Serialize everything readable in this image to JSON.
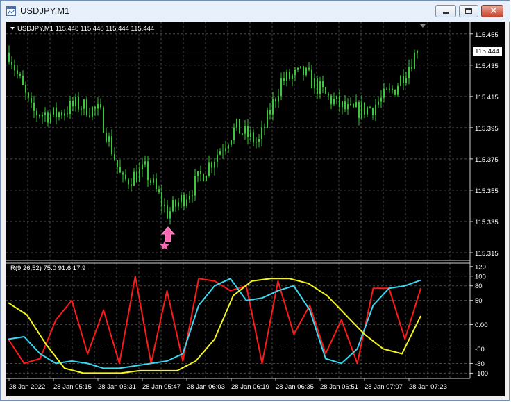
{
  "window": {
    "title": "USDJPY,M1",
    "buttons": [
      "minimize",
      "maximize",
      "close"
    ]
  },
  "colors": {
    "background": "#000000",
    "grid": "#4a4a4a",
    "candle": "#3cc83c",
    "text": "#ffffff",
    "red_line": "#ff1a1a",
    "cyan_line": "#3ad7f0",
    "yellow_line": "#f5f51e",
    "signal_arrow": "#ff69b4"
  },
  "price_panel": {
    "header": "USDJPY,M1  115.448 115.448 115.444 115.444",
    "current_price": "115.444",
    "price_labels": [
      "115.455",
      "115.435",
      "115.415",
      "115.395",
      "115.375",
      "115.355",
      "115.335",
      "115.315"
    ]
  },
  "indicator_panel": {
    "header": "R(9,26,52) 75.0 91.6 17.9",
    "scale_labels": [
      "120",
      "100",
      "80",
      "50",
      "0.00",
      "-50",
      "-80",
      "-100"
    ]
  },
  "time_axis": {
    "labels": [
      "28 Jan 2022",
      "28 Jan 05:15",
      "28 Jan 05:31",
      "28 Jan 05:47",
      "28 Jan 06:03",
      "28 Jan 06:19",
      "28 Jan 06:35",
      "28 Jan 06:51",
      "28 Jan 07:07",
      "28 Jan 07:23"
    ]
  },
  "signal": {
    "icon": "up-arrow-icon",
    "marker": "star-icon"
  },
  "chart_data": [
    {
      "type": "candlestick",
      "title": "USDJPY,M1",
      "y_range": [
        115.311,
        115.462
      ],
      "x": [
        "05:00",
        "05:08",
        "05:15",
        "05:23",
        "05:31",
        "05:39",
        "05:47",
        "05:55",
        "06:03",
        "06:11",
        "06:19",
        "06:27",
        "06:35",
        "06:43",
        "06:51",
        "06:59",
        "07:07",
        "07:15",
        "07:23"
      ],
      "close": [
        115.443,
        115.405,
        115.403,
        115.41,
        115.405,
        115.36,
        115.368,
        115.34,
        115.355,
        115.375,
        115.395,
        115.385,
        115.425,
        115.43,
        115.415,
        115.405,
        115.408,
        115.42,
        115.444
      ],
      "last": 115.444
    },
    {
      "type": "line",
      "title": "R(9,26,52)",
      "y_range": [
        -108,
        124
      ],
      "grid": true,
      "series": [
        {
          "values": [
            -30,
            -80,
            -70,
            10,
            50,
            -60,
            30,
            -80,
            100,
            -80,
            70,
            -75,
            95,
            90,
            70,
            80,
            -80,
            90,
            -20,
            40,
            -60,
            10,
            -80,
            75,
            75,
            -30,
            75
          ]
        },
        {
          "values": [
            -30,
            -25,
            -60,
            -80,
            -75,
            -80,
            -90,
            -90,
            -85,
            -80,
            -75,
            -60,
            40,
            80,
            95,
            50,
            55,
            70,
            80,
            30,
            -70,
            -80,
            -50,
            40,
            75,
            80,
            91.6
          ]
        },
        {
          "values": [
            45,
            20,
            -40,
            -90,
            -100,
            -100,
            -100,
            -95,
            -95,
            -95,
            -75,
            -30,
            60,
            90,
            95,
            95,
            85,
            60,
            20,
            -20,
            -50,
            -60,
            17.9
          ]
        }
      ]
    }
  ]
}
